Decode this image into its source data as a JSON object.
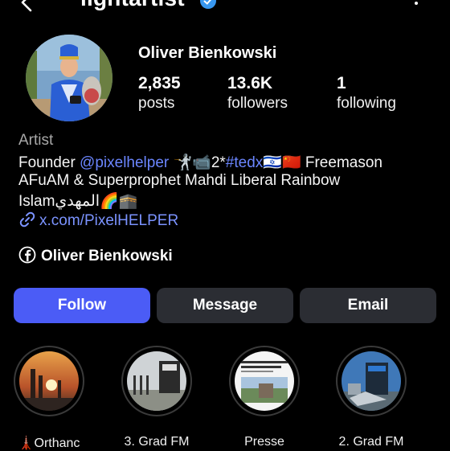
{
  "header": {
    "username": "lightartist",
    "icons": {
      "back": "back-arrow-icon",
      "verified": "verified-badge-icon",
      "more": "more-options-icon"
    }
  },
  "profile": {
    "display_name": "Oliver Bienkowski",
    "stats": [
      {
        "value": "2,835",
        "label": "posts"
      },
      {
        "value": "13.6K",
        "label": "followers"
      },
      {
        "value": "1",
        "label": "following"
      }
    ]
  },
  "bio": {
    "category": "Artist",
    "line1_prefix": "Founder ",
    "line1_mention": "@pixelhelper",
    "line1_mid": " 🤺📹2*",
    "line1_hashtag": "#tedx",
    "line1_suffix": "🇮🇱🇨🇳 Freemason",
    "line2": "AFuAM & Superprophet Mahdi Liberal Rainbow",
    "line3": "Islamالمهدي🌈🕋",
    "link": "x.com/PixelHELPER",
    "facebook_name": "Oliver Bienkowski"
  },
  "actions": {
    "follow": "Follow",
    "message": "Message",
    "email": "Email"
  },
  "highlights": [
    {
      "label": "🗼Orthanc"
    },
    {
      "label": "3. Grad FM"
    },
    {
      "label": "Presse"
    },
    {
      "label": "2. Grad FM"
    }
  ],
  "colors": {
    "background": "#000000",
    "follow_button": "#4b5cf6",
    "secondary_button": "#2b2d33",
    "link": "#6b86ff",
    "verified": "#3897f0"
  }
}
